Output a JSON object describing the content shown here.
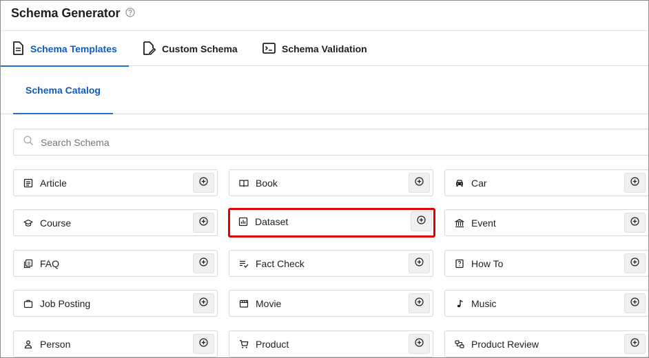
{
  "header": {
    "title": "Schema Generator",
    "help_icon": "question-circle-icon"
  },
  "tabs": [
    {
      "label": "Schema Templates",
      "icon": "document-icon",
      "active": true
    },
    {
      "label": "Custom Schema",
      "icon": "document-edit-icon",
      "active": false
    },
    {
      "label": "Schema Validation",
      "icon": "terminal-icon",
      "active": false
    }
  ],
  "subtabs": [
    {
      "label": "Schema Catalog",
      "active": true
    }
  ],
  "search": {
    "placeholder": "Search Schema",
    "value": ""
  },
  "catalog": [
    {
      "label": "Article",
      "icon": "article-icon"
    },
    {
      "label": "Book",
      "icon": "book-icon"
    },
    {
      "label": "Car",
      "icon": "car-icon"
    },
    {
      "label": "Course",
      "icon": "graduation-cap-icon"
    },
    {
      "label": "Dataset",
      "icon": "dataset-icon",
      "highlighted": true
    },
    {
      "label": "Event",
      "icon": "building-icon"
    },
    {
      "label": "FAQ",
      "icon": "faq-icon"
    },
    {
      "label": "Fact Check",
      "icon": "fact-check-icon"
    },
    {
      "label": "How To",
      "icon": "how-to-icon"
    },
    {
      "label": "Job Posting",
      "icon": "briefcase-icon"
    },
    {
      "label": "Movie",
      "icon": "movie-icon"
    },
    {
      "label": "Music",
      "icon": "music-note-icon"
    },
    {
      "label": "Person",
      "icon": "person-icon"
    },
    {
      "label": "Product",
      "icon": "cart-icon"
    },
    {
      "label": "Product Review",
      "icon": "review-icon"
    }
  ],
  "colors": {
    "accent": "#0b5cc4",
    "highlight": "#e00000",
    "border": "#d4d7dc"
  }
}
